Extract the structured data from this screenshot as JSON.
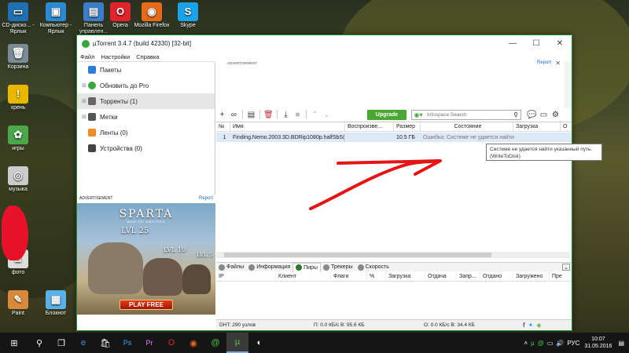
{
  "desktop": {
    "icons": [
      {
        "label": "CD-диско... - Ярлык",
        "icon": "cd-drive-icon",
        "color": "#1f6fb2",
        "glyph": "▭"
      },
      {
        "label": "Компьютер - Ярлык",
        "icon": "computer-icon",
        "color": "#2a8ad4",
        "glyph": "▣"
      },
      {
        "label": "Панель управлен...",
        "icon": "control-panel-icon",
        "color": "#3a7ec9",
        "glyph": "▤"
      },
      {
        "label": "Opera",
        "icon": "opera-icon",
        "color": "#e0242b",
        "glyph": "O"
      },
      {
        "label": "Mozilla Firefox",
        "icon": "firefox-icon",
        "color": "#e66a1a",
        "glyph": "◉"
      },
      {
        "label": "Skype",
        "icon": "skype-icon",
        "color": "#1aa3e8",
        "glyph": "S"
      },
      {
        "label": "Корзина",
        "icon": "recycle-bin-icon",
        "color": "#7a8a96",
        "glyph": "🗑"
      },
      {
        "label": "хрень",
        "icon": "warning-icon",
        "color": "#e8b800",
        "glyph": "!"
      },
      {
        "label": "игры",
        "icon": "games-icon",
        "color": "#4aa84a",
        "glyph": "✿"
      },
      {
        "label": "музыка",
        "icon": "music-icon",
        "color": "#cccccc",
        "glyph": "◎"
      },
      {
        "label": "фото",
        "icon": "photo-icon",
        "color": "#dddddd",
        "glyph": "◙"
      },
      {
        "label": "Paint",
        "icon": "paint-icon",
        "color": "#d88a3a",
        "glyph": "✎"
      },
      {
        "label": "Блокнот",
        "icon": "notepad-icon",
        "color": "#5ab0e8",
        "glyph": "▦"
      }
    ]
  },
  "window": {
    "title": "µTorrent 3.4.7  (build 42330) [32-bit]",
    "controls": {
      "minimize": "—",
      "maximize": "☐",
      "close": "✕"
    },
    "menu": [
      "Файл",
      "Настройки",
      "Справка"
    ]
  },
  "sidebar": {
    "items": [
      {
        "label": "Пакеты",
        "icon": "bundle-icon",
        "color": "#2a7ed8",
        "expandable": false
      },
      {
        "label": "Обновить до Pro",
        "icon": "utorrent-pro-icon",
        "color": "#3aa83a",
        "expandable": true
      },
      {
        "label": "Торренты (1)",
        "icon": "torrents-icon",
        "color": "#666666",
        "expandable": true
      },
      {
        "label": "Метки",
        "icon": "tag-icon",
        "color": "#555555",
        "expandable": true
      },
      {
        "label": "Ленты (0)",
        "icon": "rss-icon",
        "color": "#f08a24",
        "expandable": false
      },
      {
        "label": "Устройства (0)",
        "icon": "device-icon",
        "color": "#444444",
        "expandable": false
      }
    ]
  },
  "ads": {
    "left_label": "ADVERTISEMENT",
    "left_report": "Report",
    "top_label": "ADVERTISEMENT",
    "top_report": "Report",
    "sparta_title": "SPARTA",
    "sparta_subtitle": "WAR OF EMPIRES",
    "levels": [
      "LVL 25",
      "LVL 10",
      "LVL 5"
    ],
    "play": "PLAY FREE"
  },
  "toolbar": {
    "upgrade_label": "Upgrade",
    "search_placeholder": "Infospace Search"
  },
  "torrent_list": {
    "columns": [
      "№",
      "Имя",
      "Воспроизве...",
      "Размер",
      "Состояние",
      "Загрузка",
      "О"
    ],
    "rows": [
      {
        "num": "1",
        "name": "Finding.Nemo.2003.3D.BDRip1080p.halfSbS(...",
        "play": "",
        "size": "10.5 ГБ",
        "status": "Ошибка: Системе не удается найти у",
        "down": "",
        "up": ""
      }
    ]
  },
  "tooltip": {
    "line1": "Системе не удается найти указанный путь.",
    "line2": "(WriteToDisk)"
  },
  "detail_tabs": [
    "Файлы",
    "Информация",
    "Пиры",
    "Трекеры",
    "Скорость"
  ],
  "peers_columns": [
    "IP",
    "Клиент",
    "Флаги",
    "%",
    "Загрузка",
    "Отдача",
    "Запр...",
    "Отдано",
    "Загружено",
    "Пре"
  ],
  "status": {
    "dht": "DHT: 290 узлов",
    "download": "П: 0.0 КБ/с В: 95.6 КБ",
    "upload": "О: 0.0 КБ/с В: 34.4 КБ"
  },
  "taskbar": {
    "lang": "РУС",
    "time": "10:07",
    "date": "31.05.2016"
  }
}
